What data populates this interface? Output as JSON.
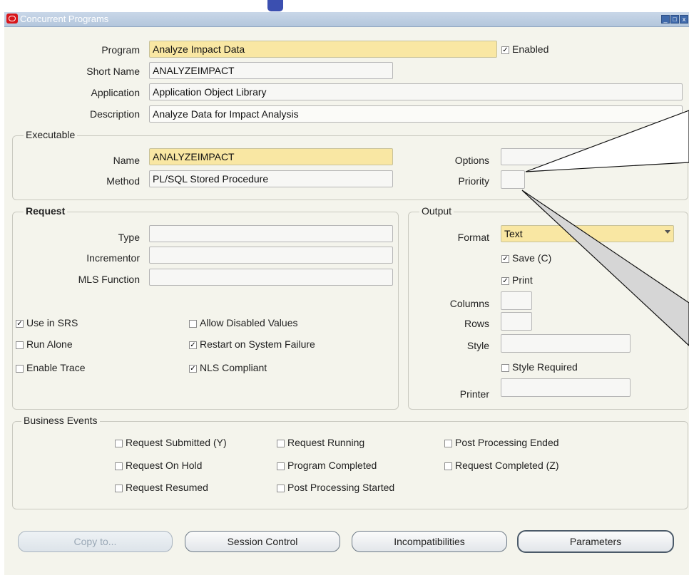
{
  "window": {
    "title": "Concurrent Programs",
    "controls": {
      "minimize": "_",
      "maximize": "□",
      "close": "x"
    }
  },
  "header_fields": {
    "program_label": "Program",
    "program_value": "Analyze Impact Data",
    "enabled_label": "Enabled",
    "enabled_checked": true,
    "short_name_label": "Short Name",
    "short_name_value": "ANALYZEIMPACT",
    "application_label": "Application",
    "application_value": "Application Object Library",
    "description_label": "Description",
    "description_value": "Analyze Data for Impact Analysis"
  },
  "executable": {
    "title": "Executable",
    "name_label": "Name",
    "name_value": "ANALYZEIMPACT",
    "method_label": "Method",
    "method_value": "PL/SQL Stored Procedure",
    "options_label": "Options",
    "options_value": "",
    "priority_label": "Priority",
    "priority_value": ""
  },
  "request": {
    "title": "Request",
    "type_label": "Type",
    "type_value": "",
    "incrementor_label": "Incrementor",
    "incrementor_value": "",
    "mls_label": "MLS Function",
    "mls_value": "",
    "use_in_srs": {
      "label": "Use in SRS",
      "checked": true
    },
    "allow_disabled": {
      "label": "Allow Disabled Values",
      "checked": false
    },
    "run_alone": {
      "label": "Run Alone",
      "checked": false
    },
    "restart": {
      "label": "Restart on System Failure",
      "checked": true
    },
    "enable_trace": {
      "label": "Enable Trace",
      "checked": false
    },
    "nls": {
      "label": "NLS Compliant",
      "checked": true
    }
  },
  "output": {
    "title": "Output",
    "format_label": "Format",
    "format_value": "Text",
    "save": {
      "label": "Save (C)",
      "checked": true
    },
    "print": {
      "label": "Print",
      "checked": true
    },
    "columns_label": "Columns",
    "columns_value": "",
    "rows_label": "Rows",
    "rows_value": "",
    "style_label": "Style",
    "style_value": "",
    "style_required": {
      "label": "Style Required",
      "checked": false
    },
    "printer_label": "Printer",
    "printer_value": ""
  },
  "business_events": {
    "title": "Business Events",
    "request_submitted": {
      "label": "Request Submitted (Y)",
      "checked": false
    },
    "request_running": {
      "label": "Request Running",
      "checked": false
    },
    "post_processing_ended": {
      "label": "Post Processing Ended",
      "checked": false
    },
    "request_on_hold": {
      "label": "Request On Hold",
      "checked": false
    },
    "program_completed": {
      "label": "Program Completed",
      "checked": false
    },
    "request_completed": {
      "label": "Request Completed (Z)",
      "checked": false
    },
    "request_resumed": {
      "label": "Request Resumed",
      "checked": false
    },
    "post_processing_started": {
      "label": "Post Processing Started",
      "checked": false
    }
  },
  "buttons": {
    "copy_to": "Copy to...",
    "session_control": "Session Control",
    "incompatibilities": "Incompatibilities",
    "parameters": "Parameters"
  },
  "colors": {
    "required_field": "#f9e7a3",
    "window_bg": "#f4f4ec",
    "titlebar": "#b3c6dc"
  }
}
